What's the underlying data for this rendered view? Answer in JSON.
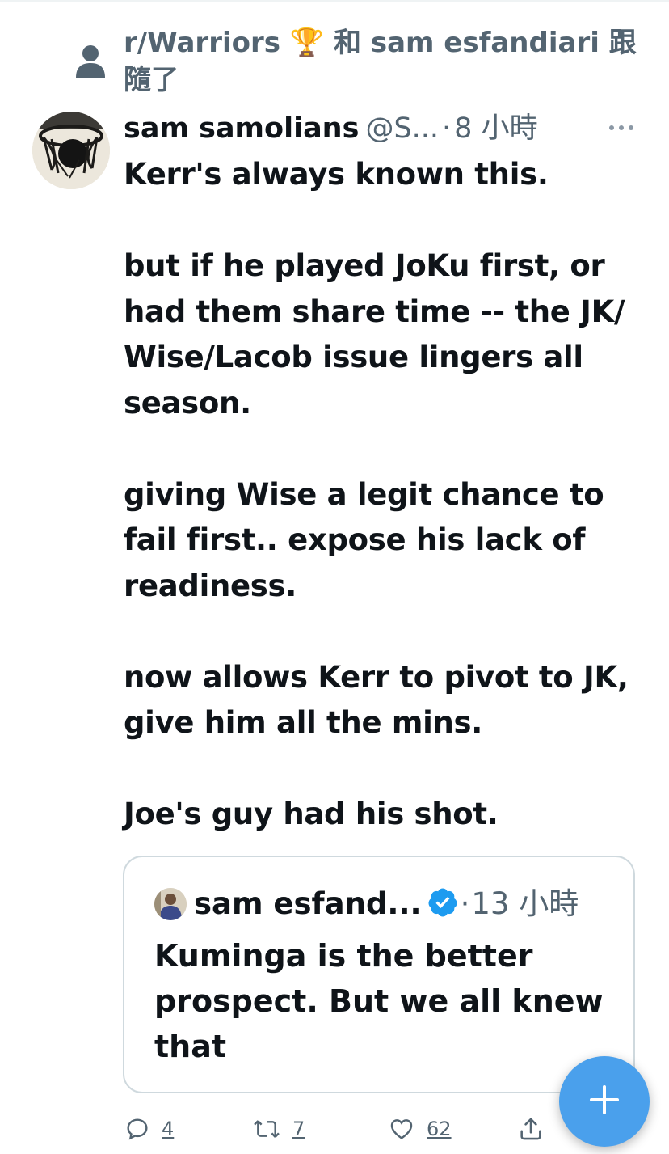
{
  "social_context": {
    "text": "r/Warriors ",
    "trophy": "🏆",
    "text_after": " 和 sam esfandiari 跟隨了",
    "icon": "person-icon"
  },
  "tweet": {
    "author_name": "sam samolians",
    "author_handle": "@S...",
    "separator": "·",
    "time": "8 小時",
    "more_icon": "more-horizontal-icon",
    "body": "Kerr's always known this.\n\nbut if he played JoKu first, or had them share time -- the JK/ Wise/Lacob issue lingers all season.\n\ngiving Wise a legit chance to fail first.. expose his lack of readiness.\n\nnow allows Kerr to pivot to JK, give him all the mins.\n\nJoe's guy had his shot."
  },
  "quote": {
    "author_name": "sam esfand...",
    "verified_icon": "verified-badge-icon",
    "separator": "·",
    "time": "13 小時",
    "body": "Kuminga is the better prospect. But we all knew that"
  },
  "actions": {
    "reply": {
      "icon": "reply-icon",
      "count": "4"
    },
    "retweet": {
      "icon": "retweet-icon",
      "count": "7"
    },
    "like": {
      "icon": "heart-icon",
      "count": "62"
    },
    "share": {
      "icon": "share-icon"
    }
  },
  "fab": {
    "icon": "plus-icon"
  },
  "colors": {
    "text_primary": "#0f1419",
    "text_secondary": "#536471",
    "accent": "#1d9bf0",
    "fab": "#4aa0ec",
    "border": "#cfd9de"
  }
}
